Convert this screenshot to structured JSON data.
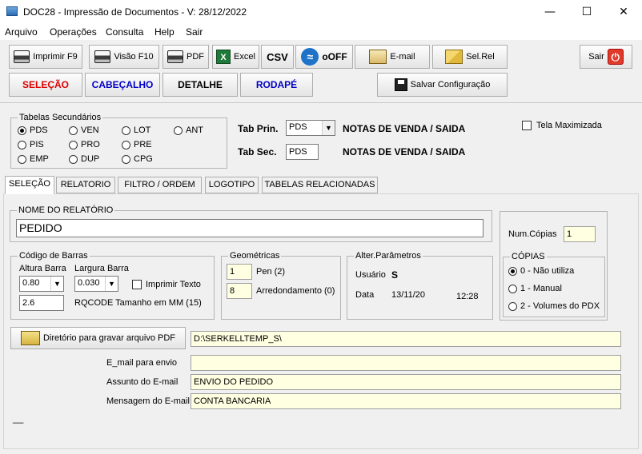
{
  "window": {
    "title": "DOC28 - Impressão de Documentos - V: 28/12/2022",
    "min": "—",
    "max": "☐",
    "close": "✕"
  },
  "menu": [
    "Arquivo",
    "Operações",
    "Consulta",
    "Help",
    "Sair"
  ],
  "toolbar": {
    "imprimir": "Imprimir F9",
    "visao": "Visão F10",
    "pdf": "PDF",
    "excel": "Excel",
    "csv": "CSV",
    "ooff": "oOFF",
    "email": "E-mail",
    "selrel": "Sel.Rel",
    "sair": "Sair",
    "selecao": "SELEÇÃO",
    "cabecalho": "CABEÇALHO",
    "detalhe": "DETALHE",
    "rodape": "RODAPÉ",
    "salvar": "Salvar Configuração"
  },
  "tabelas": {
    "legend": "Tabelas Secundários",
    "options": [
      "PDS",
      "VEN",
      "LOT",
      "ANT",
      "PIS",
      "PRO",
      "PRE",
      "EMP",
      "DUP",
      "CPG"
    ],
    "selected": "PDS"
  },
  "tab_prin": {
    "label": "Tab Prin.",
    "value": "PDS",
    "desc": "NOTAS DE VENDA / SAIDA"
  },
  "tab_sec": {
    "label": "Tab Sec.",
    "value": "PDS",
    "desc": "NOTAS DE VENDA / SAIDA"
  },
  "tela_max": "Tela Maximizada",
  "tabs": [
    "SELEÇÃO",
    "RELATORIO",
    "FILTRO / ORDEM",
    "LOGOTIPO",
    "TABELAS RELACIONADAS"
  ],
  "nome_relatorio": {
    "legend": "NOME DO RELATÓRIO",
    "value": "PEDIDO"
  },
  "num_copias": {
    "label": "Num.Cópias",
    "value": "1"
  },
  "copias": {
    "legend": "CÓPIAS",
    "options": [
      "0 - Não utiliza",
      "1 - Manual",
      "2 - Volumes do PDX"
    ],
    "selected": 0
  },
  "codigo_barras": {
    "legend": "Código de Barras",
    "altura_label": "Altura Barra",
    "altura": "0.80",
    "largura_label": "Largura Barra",
    "largura": "0.030",
    "imprimir_texto": "Imprimir Texto",
    "qr_value": "2.6",
    "qr_label": "RQCODE Tamanho em MM (15)"
  },
  "geometricas": {
    "legend": "Geométricas",
    "pen": "1",
    "pen_label": "Pen (2)",
    "arred": "8",
    "arred_label": "Arredondamento (0)"
  },
  "alter": {
    "legend": "Alter.Parâmetros",
    "usuario_label": "Usuário",
    "usuario": "S",
    "data_label": "Data",
    "data": "13/11/20",
    "hora": "12:28"
  },
  "dir_pdf": {
    "button": "Diretório para gravar arquivo PDF",
    "value": "D:\\SERKELLTEMP_S\\"
  },
  "email": {
    "para_label": "E_mail para envio",
    "para": "",
    "assunto_label": "Assunto do E-mail",
    "assunto": "ENVIO DO PEDIDO",
    "mensagem_label": "Mensagem do E-mail",
    "mensagem": "CONTA BANCARIA"
  },
  "bottom_mark": "__"
}
